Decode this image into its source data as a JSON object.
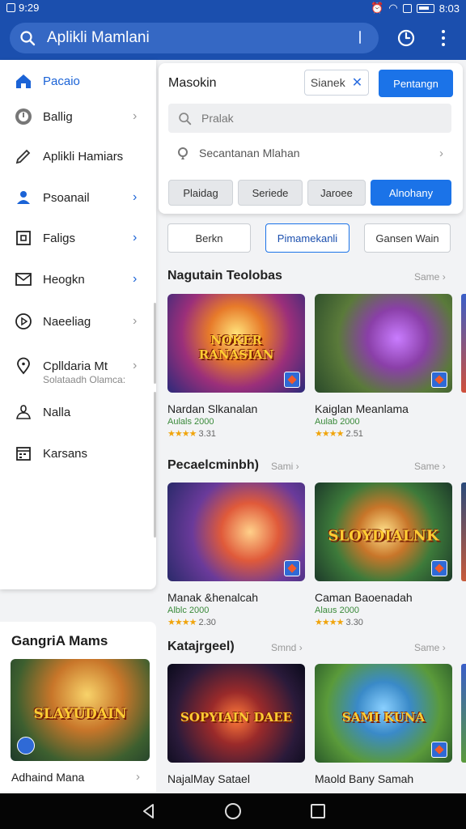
{
  "status": {
    "time": "9:29",
    "time_right": "8:03"
  },
  "search": {
    "text": "Aplikli Mamlani"
  },
  "drawer": {
    "items": [
      {
        "label": "Pacaio",
        "icon": "home-icon",
        "active": true
      },
      {
        "label": "Ballig",
        "icon": "clock-icon"
      },
      {
        "label": "Aplikli Hamiars",
        "icon": "pencil-icon"
      },
      {
        "label": "Psoanail",
        "icon": "people-icon"
      },
      {
        "label": "Faligs",
        "icon": "grid-icon"
      },
      {
        "label": "Heogkn",
        "icon": "mail-icon"
      },
      {
        "label": "Naeeliag",
        "icon": "play-circle-icon"
      },
      {
        "label": "Cplldaria Mt",
        "sub": "Solataadh Olamca:",
        "icon": "location-pin-icon"
      },
      {
        "label": "Nalla",
        "icon": "person-icon"
      },
      {
        "label": "Karsans",
        "icon": "calendar-icon"
      }
    ]
  },
  "left_card": {
    "title": "GangriA Mams",
    "game_name": "Adhaind Mana",
    "logo": "SLAYUDAIN"
  },
  "filter": {
    "title": "Masokin",
    "chip": "Sianek",
    "primary": "Pentangn",
    "search_placeholder": "Pralak",
    "location": "Secantanan Mlahan",
    "segments": [
      "Plaidag",
      "Seriede",
      "Jaroee",
      "Alnohany"
    ]
  },
  "sort": {
    "options": [
      "Berkn",
      "Pimamekanli",
      "Gansen Wain"
    ]
  },
  "sections": [
    {
      "title": "Nagutain Teolobas",
      "more": "Same",
      "more2": "",
      "games": [
        {
          "name": "Nardan Slkanalan",
          "price": "Aulals  2000",
          "rating": "3.31",
          "logo": "NOKER RANASIAN"
        },
        {
          "name": "Kaiglan Meanlama",
          "price": "Aulab  2000",
          "rating": "2.51",
          "logo": ""
        }
      ]
    },
    {
      "title": "Pecaelcminbh)",
      "more": "Same",
      "more2": "Sami",
      "games": [
        {
          "name": "Manak &henalcah",
          "price": "Alblc  2000",
          "rating": "2.30",
          "logo": ""
        },
        {
          "name": "Caman Baoenadah",
          "price": "Alaus  2000",
          "rating": "3.30",
          "logo": "SLOYDIALNK"
        }
      ]
    },
    {
      "title": "Katajrgeel)",
      "more": "Same",
      "more2": "Smnd",
      "games": [
        {
          "name": "NajalMay Satael",
          "price": "",
          "rating": "",
          "logo": "SOPYIAIN DAEE"
        },
        {
          "name": "Maold Bany Samah",
          "price": "",
          "rating": "",
          "logo": "SAMI KUNA"
        }
      ]
    }
  ]
}
